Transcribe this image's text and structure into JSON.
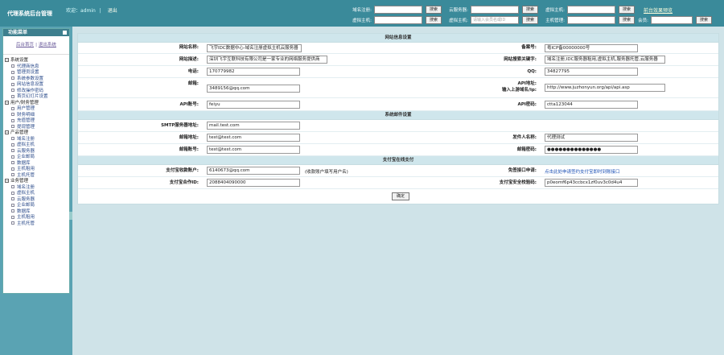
{
  "header": {
    "brand": "代理系统后台管理",
    "welcome_prefix": "欢迎：",
    "username": "admin",
    "separator": "|",
    "logout": "退出",
    "search_rows": [
      [
        {
          "label": "域名注册:",
          "value": "",
          "button": "搜索"
        },
        {
          "label": "云服务器:",
          "value": "",
          "button": "搜索"
        },
        {
          "label": "虚拟主机:",
          "value": "",
          "button": "搜索"
        }
      ],
      [
        {
          "label": "虚拟主机:",
          "value": "",
          "button": "搜索"
        },
        {
          "label": "虚拟主机:",
          "value": "请输入会员名或ID",
          "button": "搜索"
        },
        {
          "label": "主机管理:",
          "value": "",
          "button": "搜索"
        },
        {
          "label": "会员:",
          "value": "",
          "button": "搜索"
        }
      ]
    ],
    "top_link": "前台效果预览"
  },
  "sidebar": {
    "title": "功能菜单",
    "links": [
      "后台首页",
      "退出系统"
    ],
    "groups": [
      {
        "name": "系统设置",
        "items": [
          "代理商信息",
          "管理员设置",
          "系统参数设置",
          "网站信息设置",
          "修改操作密码",
          "首页幻灯片设置"
        ]
      },
      {
        "name": "用户/财务管理",
        "items": [
          "用户管理",
          "财务明细",
          "充值管理",
          "提现管理"
        ]
      },
      {
        "name": "产品管理",
        "items": [
          "域名注册",
          "虚拟主机",
          "云服务器",
          "企业邮局",
          "数据库",
          "主机租用",
          "主机托管"
        ]
      },
      {
        "name": "业务管理",
        "items": [
          "域名注册",
          "虚拟主机",
          "云服务器",
          "企业邮局",
          "数据库",
          "主机租用",
          "主机托管"
        ]
      }
    ]
  },
  "main": {
    "sections": {
      "site": "网站信息设置",
      "mail": "系统邮件设置",
      "pay": "支付宝在线支付"
    },
    "site": {
      "name_label": "网站名称:",
      "name_value": "飞宇IDC数据中心-域名注册虚拟主机云服务器",
      "icp_label": "备案号:",
      "icp_value": "粤ICP备00000000号",
      "desc_label": "网站描述:",
      "desc_value": "深圳飞宇互联科技有限公司是一家专业的网络服务提供商",
      "keywords_label": "网站搜索关键字:",
      "keywords_value": "域名注册,IDC服务器租用,虚拟主机,服务器托管,云服务器",
      "tel_label": "电话:",
      "tel_value": "170779982",
      "qq_label": "QQ:",
      "qq_value": "34827795",
      "email_label": "邮箱:",
      "email_value": "3489156@qq.com",
      "api_label": "API地址:",
      "api_hint": "输入上游域名/ip:",
      "api_value": "http://www.juzhonyun.org/api/api.asp",
      "apiacct_label": "API账号:",
      "apiacct_value": "feiyu",
      "apipwd_label": "API密码:",
      "apipwd_value": "ctta123044"
    },
    "mail": {
      "smtp_label": "SMTP服务器地址:",
      "smtp_value": "mail.test.com",
      "addr_label": "邮箱地址:",
      "addr_value": "test@test.com",
      "sender_label": "发件人名称:",
      "sender_value": "代理测试",
      "acct_label": "邮箱账号:",
      "acct_value": "test@test.com",
      "pwd_label": "邮箱密码:",
      "pwd_value": "●●●●●●●●●●●●●●"
    },
    "pay": {
      "acct_label": "支付宝收款账户:",
      "acct_value": "6140673@qq.com",
      "acct_hint": "(收款账户填写用户名)",
      "apply_label": "免签接口申请:",
      "apply_link": "点击此处申请签约支付宝即时到账接口",
      "partner_label": "支付宝合作ID:",
      "partner_value": "2088404090000",
      "key_label": "支付宝安全校验码:",
      "key_value": "p0eomf6p43ccbcx1zf0uv3c0d4u4"
    },
    "submit": "确定"
  }
}
